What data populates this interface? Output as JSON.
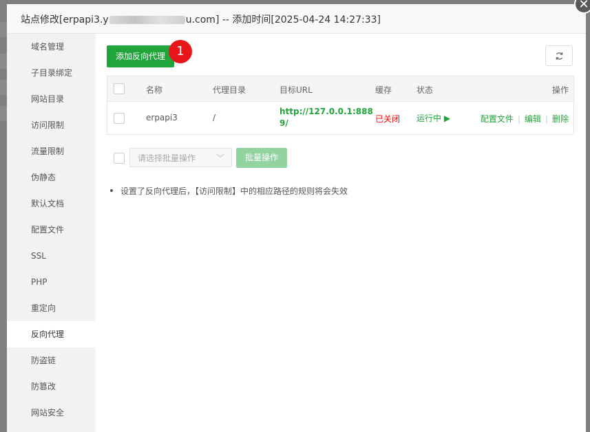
{
  "window": {
    "title_prefix": "站点修改[erpapi3.y",
    "title_suffix": "u.com] -- 添加时间[2025-04-24 14:27:33]",
    "close_symbol": "✕"
  },
  "sidebar": {
    "items": [
      {
        "label": "域名管理"
      },
      {
        "label": "子目录绑定"
      },
      {
        "label": "网站目录"
      },
      {
        "label": "访问限制"
      },
      {
        "label": "流量限制"
      },
      {
        "label": "伪静态"
      },
      {
        "label": "默认文档"
      },
      {
        "label": "配置文件"
      },
      {
        "label": "SSL"
      },
      {
        "label": "PHP"
      },
      {
        "label": "重定向"
      },
      {
        "label": "反向代理"
      },
      {
        "label": "防盗链"
      },
      {
        "label": "防篡改"
      },
      {
        "label": "网站安全"
      }
    ],
    "active": "反向代理"
  },
  "toolbar": {
    "add_label": "添加反向代理",
    "badge": "1",
    "refresh_icon": "refresh-icon"
  },
  "table": {
    "headers": {
      "name": "名称",
      "proxy_dir": "代理目录",
      "target_url": "目标URL",
      "cache": "缓存",
      "status": "状态",
      "actions": "操作"
    },
    "rows": [
      {
        "name": "erpapi3",
        "proxy_dir": "/",
        "target_url_line1": "http://127.0.0.1:888",
        "target_url_line2": "9/",
        "cache": "已关闭",
        "status": "运行中",
        "status_icon": "▶",
        "action_config": "配置文件",
        "action_edit": "编辑",
        "action_delete": "删除"
      }
    ]
  },
  "batch": {
    "select_placeholder": "请选择批量操作",
    "select_arrow": "﹀",
    "button_label": "批量操作"
  },
  "notes": [
    "设置了反向代理后，【访问限制】中的相应路径的规则将会失效"
  ],
  "colors": {
    "accent": "#20a53a",
    "danger": "#ef0808",
    "badge": "#e8151b"
  }
}
